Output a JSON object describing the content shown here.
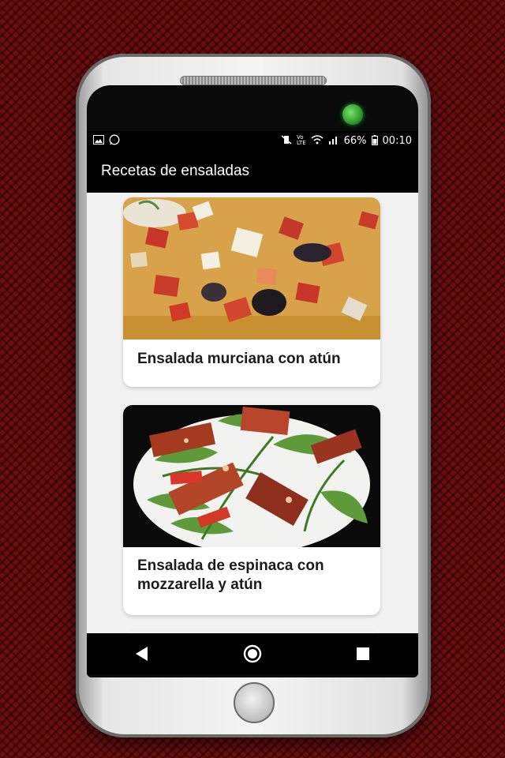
{
  "status_bar": {
    "battery": "66%",
    "time": "00:10"
  },
  "app_bar": {
    "title": "Recetas de ensaladas"
  },
  "recipes": [
    {
      "title": "Ensalada murciana con atún"
    },
    {
      "title": "Ensalada de espinaca con mozzarella y atún"
    }
  ],
  "icons": {
    "status_left": [
      "image-icon",
      "whatsapp-icon"
    ],
    "status_right": [
      "vibrate-mute-icon",
      "volte-icon",
      "wifi-icon",
      "signal-icon",
      "battery-icon"
    ],
    "nav": [
      "back-icon",
      "home-icon",
      "recents-icon"
    ]
  },
  "colors": {
    "bar_background": "#000000",
    "card_background": "#ffffff",
    "screen_background": "#f2f2f2"
  }
}
